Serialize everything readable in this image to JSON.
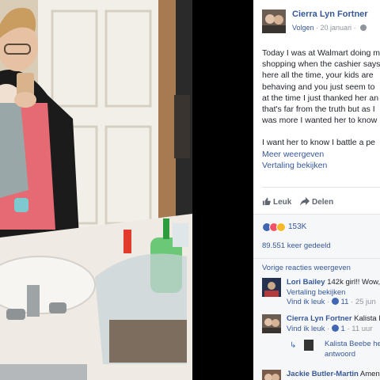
{
  "post": {
    "author": "Cierra Lyn Fortner",
    "follow_label": "Volgen",
    "date": "20 januari",
    "separator": " · ",
    "text_lines": [
      "Today I was at Walmart doing m",
      "shopping when the cashier says",
      "here all the time, your kids are",
      "behaving and you just seem to",
      "at the time I just thanked her an",
      "that's far from the truth but as I",
      "was more I wanted her to know"
    ],
    "text_line2": "I want her to know I battle a pe",
    "see_more": "Meer weergeven",
    "see_translation": "Vertaling bekijken"
  },
  "actions": {
    "like_label": "Leuk",
    "share_label": "Delen"
  },
  "stats": {
    "reactions_count": "153K",
    "shares": "89.551 keer gedeeld",
    "colors": {
      "like": "#4267b2",
      "love": "#f25268",
      "haha": "#f7b928"
    }
  },
  "comments": {
    "previous_label": "Vorige reacties weergeven",
    "items": [
      {
        "author": "Lori Bailey",
        "text": " 142k girl!! Wow,",
        "translate": "Vertaling bekijken",
        "like": "Vind ik leuk",
        "sep": " · ",
        "count": "11",
        "time": "25 jun"
      },
      {
        "author": "Cierra Lyn Fortner",
        "text": " Kalista B",
        "like": "Vind ik leuk",
        "sep": " · ",
        "count": "1",
        "time": "11 uur"
      },
      {
        "author": "Jackie Butler-Martin",
        "text": " Amen!"
      }
    ],
    "reply": {
      "text_line1": "Kalista Beebe heef",
      "text_line2": "antwoord"
    }
  }
}
